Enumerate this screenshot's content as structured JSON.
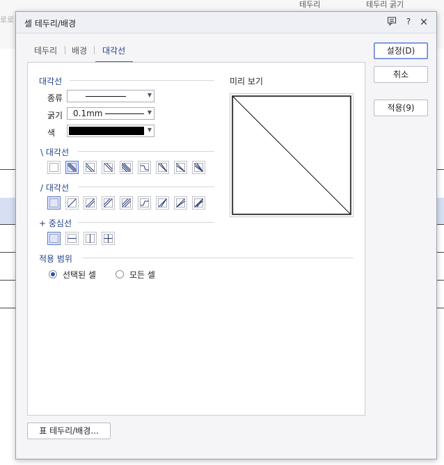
{
  "dialog": {
    "title": "셀 테두리/배경",
    "titlebar_icons": [
      "comment-icon",
      "help-icon",
      "close-icon"
    ],
    "help_label": "?",
    "close_label": "×"
  },
  "tabs": [
    {
      "label": "테두리",
      "active": false
    },
    {
      "label": "배경",
      "active": false
    },
    {
      "label": "대각선",
      "active": true
    }
  ],
  "diagonal_section": {
    "title": "대각선",
    "type_label": "종류",
    "thickness_label": "굵기",
    "thickness_value": "0.1mm",
    "color_label": "색",
    "color_value": "#000000"
  },
  "backslash_section": {
    "title": "\\ 대각선",
    "selected_index": 1,
    "count": 9
  },
  "slash_section": {
    "title": "/ 대각선",
    "selected_index": 0,
    "count": 9
  },
  "center_section": {
    "title": "+ 중심선",
    "selected_index": 0,
    "count": 4
  },
  "preview": {
    "title": "미리 보기"
  },
  "scope": {
    "title": "적용 범위",
    "options": [
      {
        "label": "선택된 셀",
        "checked": true
      },
      {
        "label": "모든 셀",
        "checked": false
      }
    ]
  },
  "buttons": {
    "ok": "설정(D)",
    "cancel": "취소",
    "apply": "적용(9)",
    "table_border": "표 테두리/배경..."
  },
  "background": {
    "toolbar_right_1": "테두리",
    "toolbar_right_2": "테두리 굵기",
    "left_fragment": "로로"
  },
  "colors": {
    "accent": "#3a63c7",
    "selected_fill": "#dfe6fb",
    "section_title": "#1f3f8a"
  }
}
